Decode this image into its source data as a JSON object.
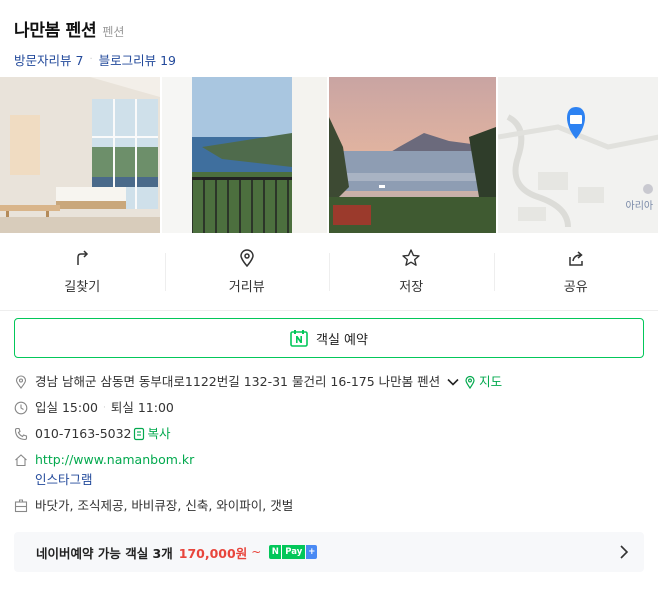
{
  "header": {
    "title": "나만봄 펜션",
    "category": "펜션",
    "visitor_reviews": "방문자리뷰 7",
    "blog_reviews": "블로그리뷰 19"
  },
  "photos": [
    {
      "name": "room-interior-photo"
    },
    {
      "name": "balcony-sea-view-photo"
    },
    {
      "name": "sunset-sea-photo"
    },
    {
      "name": "map-thumbnail"
    }
  ],
  "map": {
    "label": "아리아"
  },
  "actions": [
    {
      "label": "길찾기",
      "icon": "directions-icon"
    },
    {
      "label": "거리뷰",
      "icon": "pin-icon"
    },
    {
      "label": "저장",
      "icon": "star-icon"
    },
    {
      "label": "공유",
      "icon": "share-icon"
    }
  ],
  "booking": {
    "label": "객실 예약",
    "icon": "naver-calendar-icon"
  },
  "info": {
    "address": "경남 남해군 삼동면 동부대로1122번길 132-31 물건리 16-175 나만봄 펜션",
    "map_link": "지도",
    "checkin": "입실 15:00",
    "checkout": "퇴실 11:00",
    "phone": "010-7163-5032",
    "copy": "복사",
    "website": "http://www.namanbom.kr",
    "instagram": "인스타그램",
    "facilities": "바닷가, 조식제공, 바비큐장, 신축, 와이파이, 갯벌"
  },
  "offer": {
    "label": "네이버예약 가능 객실 3개",
    "price": "170,000원",
    "tilde": "~",
    "pay_n": "N",
    "pay_label": "Pay",
    "pay_plus": "+"
  },
  "colors": {
    "accent_green": "#03c75a",
    "link_blue": "#234a9b",
    "price_red": "#e8453c"
  }
}
